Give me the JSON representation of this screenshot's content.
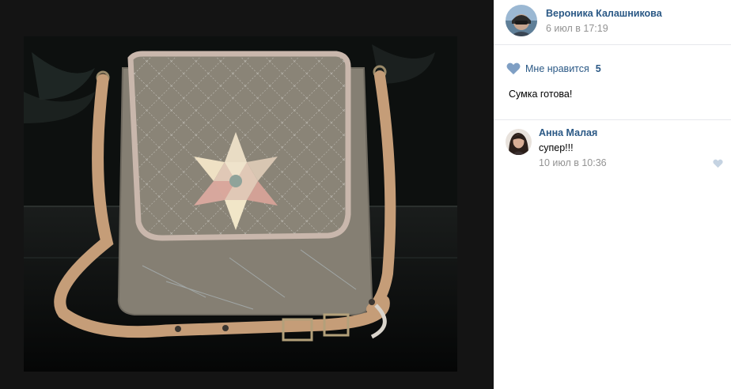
{
  "post": {
    "author": "Вероника Калашникова",
    "date": "6 июл в 17:19",
    "likes_label": "Мне нравится",
    "likes_count": "5",
    "caption": "Сумка готова!"
  },
  "comment": {
    "author": "Анна Малая",
    "text": "супер!!!",
    "date": "10 июл в 10:36"
  },
  "icons": {
    "like": "heart-icon",
    "comment_like": "heart-icon"
  },
  "colors": {
    "link": "#2a5885",
    "muted": "#939393",
    "heart": "#7f9fc4",
    "viewer_bg": "#141414"
  }
}
